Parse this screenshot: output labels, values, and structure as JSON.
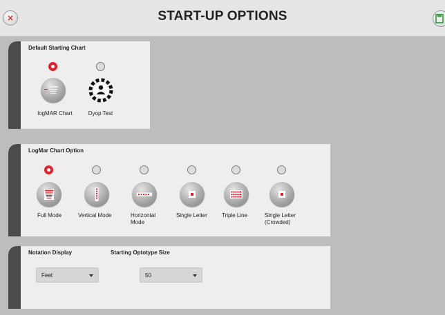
{
  "header": {
    "title": "START-UP OPTIONS",
    "close_icon": "×"
  },
  "default_chart": {
    "title": "Default Starting Chart",
    "options": [
      {
        "label": "logMAR Chart",
        "selected": true
      },
      {
        "label": "Dyop Test",
        "selected": false
      }
    ]
  },
  "logmar_option": {
    "title": "LogMar Chart Option",
    "modes": [
      {
        "label": "Full Mode",
        "selected": true
      },
      {
        "label": "Vertical  Mode",
        "selected": false
      },
      {
        "label": "Horizontal Mode",
        "selected": false
      },
      {
        "label": "Single Letter",
        "selected": false
      },
      {
        "label": "Triple Line",
        "selected": false
      },
      {
        "label": "Single Letter (Crowded)",
        "selected": false
      }
    ]
  },
  "notation": {
    "label": "Notation Display",
    "value": "Feet"
  },
  "optotype": {
    "label": "Starting Optotype Size",
    "value": "50"
  },
  "colors": {
    "accent": "#e2212a",
    "stripe": "#4b4b4b",
    "save": "#2e9a3a"
  }
}
